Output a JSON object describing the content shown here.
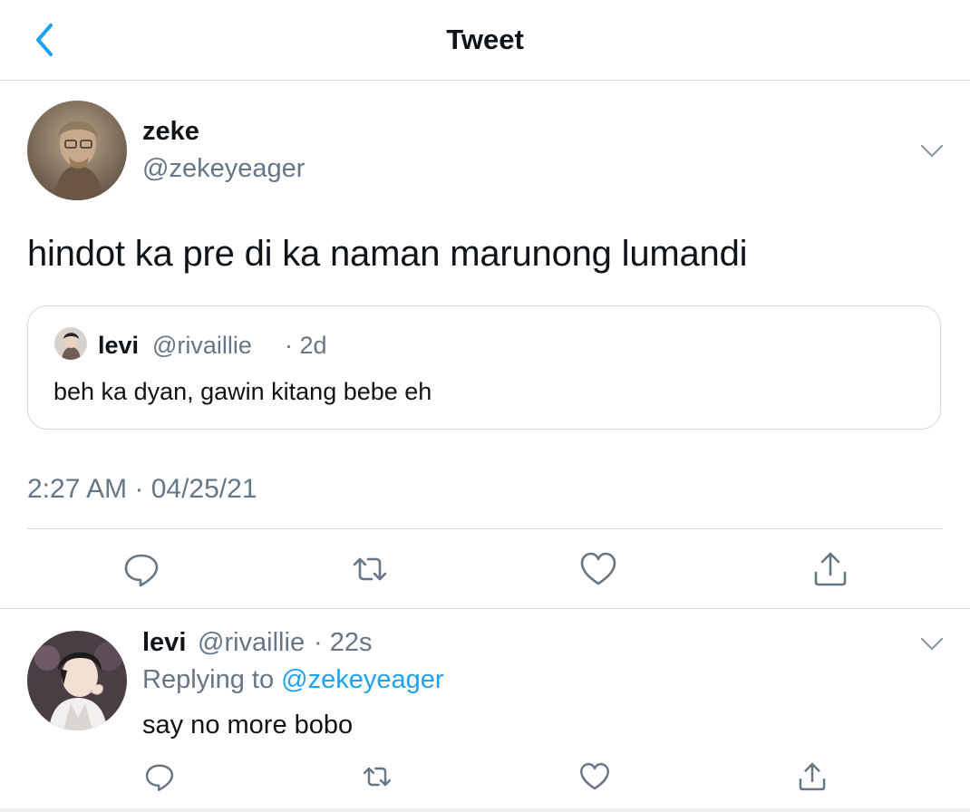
{
  "header": {
    "title": "Tweet",
    "back_icon": "chevron-left-icon",
    "accent": "#1da1f2"
  },
  "tweet": {
    "name": "zeke",
    "handle": "@zekeyeager",
    "text": "hindot ka pre di ka naman marunong lumandi",
    "timestamp": "2:27 AM · 04/25/21",
    "quote": {
      "name": "levi",
      "handle": "@rivaillie",
      "time": "· 2d",
      "text": "beh ka dyan, gawin kitang bebe eh"
    },
    "actions": [
      "reply-icon",
      "retweet-icon",
      "like-icon",
      "share-icon"
    ]
  },
  "reply": {
    "name": "levi",
    "handle": "@rivaillie",
    "time": "· 22s",
    "replying_prefix": "Replying to",
    "replying_to": "@zekeyeager",
    "text": "say no more bobo"
  },
  "colors": {
    "text": "#0f1419",
    "secondary": "#657786",
    "link": "#1da1f2",
    "border": "#d6d6d6"
  }
}
